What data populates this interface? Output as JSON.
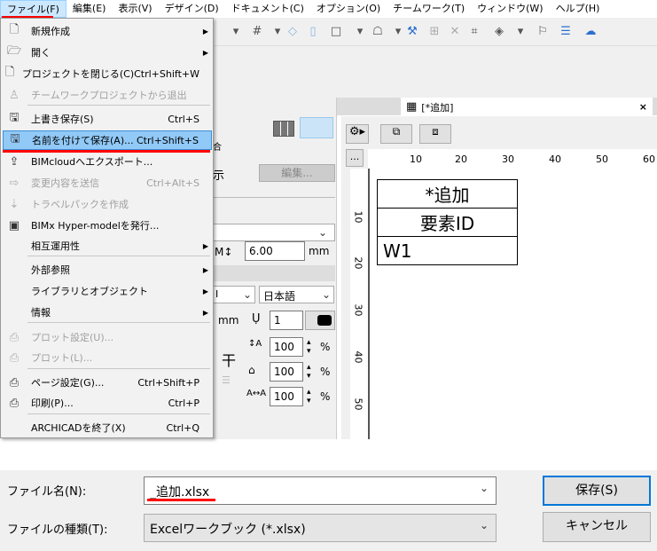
{
  "menubar": [
    "ファイル(F)",
    "編集(E)",
    "表示(V)",
    "デザイン(D)",
    "ドキュメント(C)",
    "オプション(O)",
    "チームワーク(T)",
    "ウィンドウ(W)",
    "ヘルプ(H)"
  ],
  "file_menu": [
    {
      "label": "新規作成",
      "icon": "new-document-icon",
      "submenu": true
    },
    {
      "label": "開く",
      "icon": "open-folder-icon",
      "submenu": true
    },
    {
      "label": "プロジェクトを閉じる(C)",
      "shortcut": "Ctrl+Shift+W",
      "icon": "close-document-icon"
    },
    {
      "label": "チームワークプロジェクトから退出",
      "icon": "leave-teamwork-icon",
      "disabled": true
    },
    {
      "label": "上書き保存(S)",
      "shortcut": "Ctrl+S",
      "icon": "save-icon"
    },
    {
      "label": "名前を付けて保存(A)...",
      "shortcut": "Ctrl+Shift+S",
      "icon": "save-as-icon",
      "highlighted": true
    },
    {
      "label": "BIMcloudへエクスポート...",
      "icon": "export-icon"
    },
    {
      "label": "変更内容を送信",
      "shortcut": "Ctrl+Alt+S",
      "icon": "send-arrow-icon",
      "disabled": true
    },
    {
      "label": "トラベルパックを作成",
      "icon": "travel-pack-icon",
      "disabled": true
    },
    {
      "label": "BIMx Hyper-modelを発行...",
      "icon": "bimx-icon"
    },
    {
      "label": "相互運用性",
      "submenu": true
    },
    {
      "label": "外部参照",
      "submenu": true
    },
    {
      "label": "ライブラリとオブジェクト",
      "submenu": true
    },
    {
      "label": "情報",
      "submenu": true
    },
    {
      "label": "プロット設定(U)...",
      "icon": "plot-setup-icon",
      "disabled": true
    },
    {
      "label": "プロット(L)...",
      "icon": "plot-icon",
      "disabled": true
    },
    {
      "label": "ページ設定(G)...",
      "shortcut": "Ctrl+Shift+P",
      "icon": "page-setup-icon"
    },
    {
      "label": "印刷(P)...",
      "shortcut": "Ctrl+P",
      "icon": "print-icon"
    },
    {
      "label": "ARCHICADを終了(X)",
      "shortcut": "Ctrl+Q"
    }
  ],
  "panel": {
    "text_fragment": "示",
    "edit_button": "編集...",
    "partial": "合",
    "size_value": "6.00",
    "unit": "mm",
    "font_partial": "I",
    "language": "日本語",
    "pen_unit": "mm",
    "pen_value": "1",
    "scale1": "100",
    "scale2": "100",
    "scale3": "100",
    "percent": "%"
  },
  "doc_tab": {
    "title": "[*追加]",
    "close": "×"
  },
  "schedule": {
    "more_button": "...",
    "ruler_h": [
      "10",
      "20",
      "30",
      "40",
      "50",
      "60"
    ],
    "ruler_v": [
      "10",
      "20",
      "30",
      "40",
      "50"
    ],
    "rows": [
      "*追加",
      "要素ID",
      "W1"
    ]
  },
  "dialog": {
    "filename_label": "ファイル名(N):",
    "filename_value": "_追加.xlsx",
    "filetype_label": "ファイルの種類(T):",
    "filetype_value": "Excelワークブック (*.xlsx)",
    "save_button": "保存(S)",
    "cancel_button": "キャンセル"
  }
}
